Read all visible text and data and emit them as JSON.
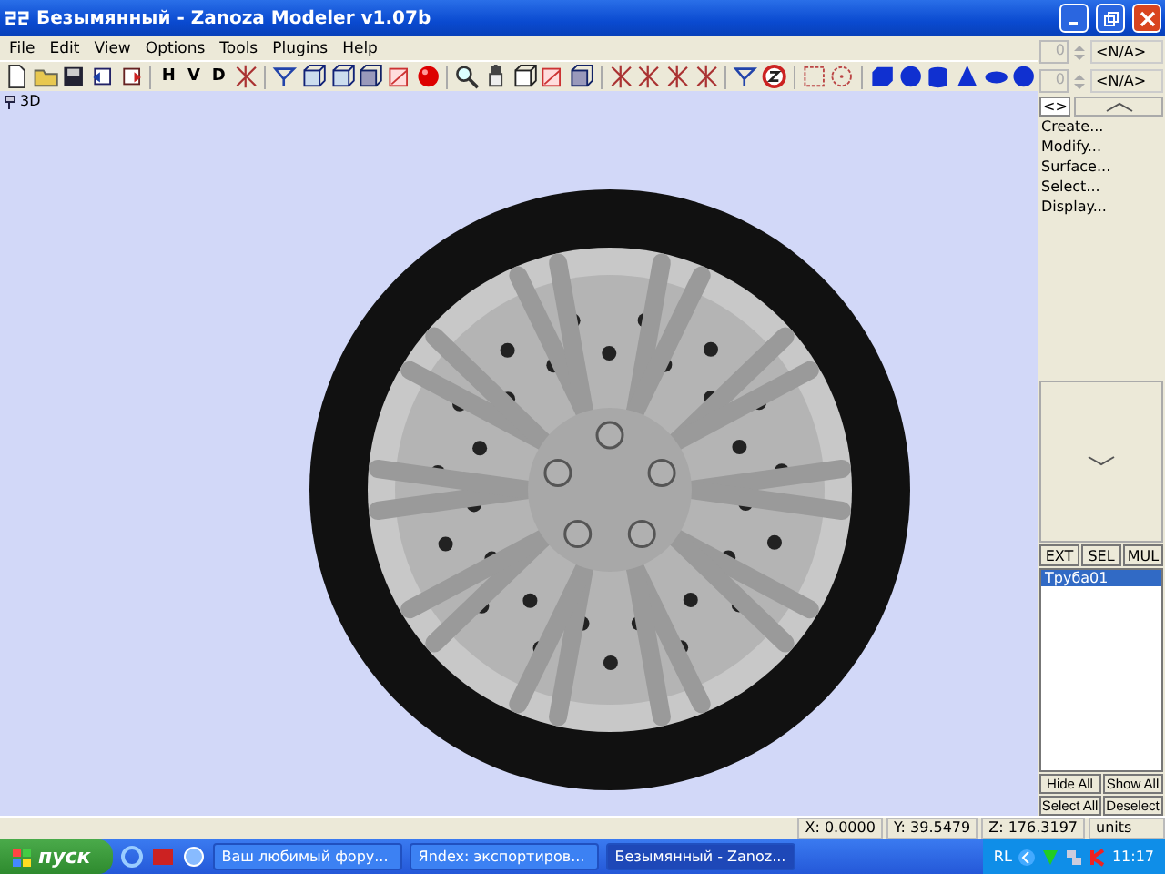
{
  "window": {
    "title": "Безымянный - Zanoza Modeler v1.07b"
  },
  "menu": [
    "File",
    "Edit",
    "View",
    "Options",
    "Tools",
    "Plugins",
    "Help"
  ],
  "toolbar": {
    "letters": [
      {
        "label": "H"
      },
      {
        "label": "V"
      },
      {
        "label": "D"
      }
    ]
  },
  "viewport": {
    "label": "3D"
  },
  "panel": {
    "spinners": [
      {
        "value": "0",
        "label": "<N/A>"
      },
      {
        "value": "0",
        "label": "<N/A>"
      }
    ],
    "toggle": "<>",
    "commands": [
      "Create...",
      "Modify...",
      "Surface...",
      "Select...",
      "Display..."
    ],
    "modes": [
      "EXT",
      "SEL",
      "MUL"
    ],
    "objects": [
      {
        "label": "Труба01",
        "selected": true
      }
    ],
    "buttons": [
      "Hide All",
      "Show All",
      "Select All",
      "Deselect"
    ]
  },
  "status_bar": {
    "fields": [
      "X: 0.0000",
      "Y: 39.5479",
      "Z: 176.3197",
      "units"
    ]
  },
  "taskbar": {
    "start": "пуск",
    "tasks": [
      {
        "label": "Ваш любимый фору...",
        "selected": false
      },
      {
        "label": "Яndex: экспортиров...",
        "selected": false
      },
      {
        "label": "Безымянный - Zanoz...",
        "selected": true
      }
    ],
    "language": "RL",
    "clock": "11:17"
  }
}
